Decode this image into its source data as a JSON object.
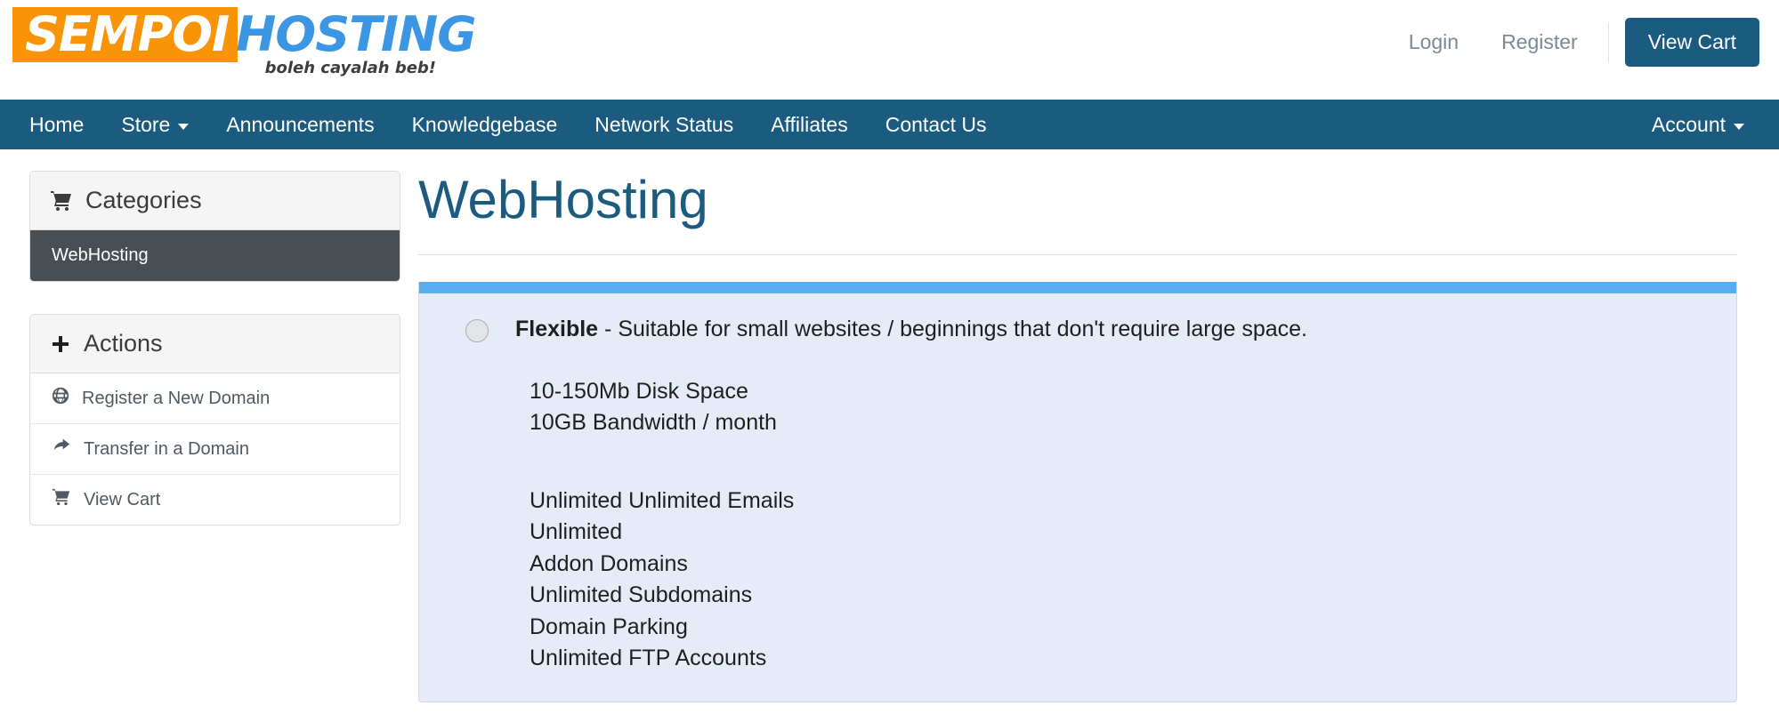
{
  "brand": {
    "logo_part1": "SEMPOI",
    "logo_part2": "HOSTING",
    "tagline": "boleh cayalah beb!"
  },
  "header": {
    "login_label": "Login",
    "register_label": "Register",
    "view_cart_label": "View Cart"
  },
  "nav": {
    "items": [
      {
        "label": "Home",
        "caret": false
      },
      {
        "label": "Store",
        "caret": true
      },
      {
        "label": "Announcements",
        "caret": false
      },
      {
        "label": "Knowledgebase",
        "caret": false
      },
      {
        "label": "Network Status",
        "caret": false
      },
      {
        "label": "Affiliates",
        "caret": false
      },
      {
        "label": "Contact Us",
        "caret": false
      }
    ],
    "account_label": "Account"
  },
  "sidebar": {
    "categories": {
      "heading": "Categories",
      "heading_icon": "cart-icon",
      "items": [
        {
          "label": "WebHosting",
          "active": true
        }
      ]
    },
    "actions": {
      "heading": "Actions",
      "heading_icon": "plus-icon",
      "items": [
        {
          "label": "Register a New Domain",
          "icon": "globe-icon"
        },
        {
          "label": "Transfer in a Domain",
          "icon": "arrow-right-curve-icon"
        },
        {
          "label": "View Cart",
          "icon": "cart-icon"
        }
      ]
    }
  },
  "main": {
    "page_title": "WebHosting",
    "product": {
      "name": "Flexible",
      "separator": "-",
      "description": "Suitable for small websites / beginnings that don't require large space.",
      "specs_group_1": [
        "10-150Mb Disk Space",
        "10GB Bandwidth / month"
      ],
      "specs_group_2": [
        "Unlimited Unlimited Emails",
        "Unlimited",
        "Addon Domains",
        "Unlimited Subdomains",
        "Domain Parking",
        "Unlimited FTP Accounts"
      ]
    }
  },
  "colors": {
    "brand_orange": "#f89406",
    "brand_blue": "#3b97e3",
    "nav_blue": "#1b5b80",
    "panel_accent": "#5aaeee",
    "panel_bg": "#e6ecf7",
    "active_item": "#474f54"
  }
}
